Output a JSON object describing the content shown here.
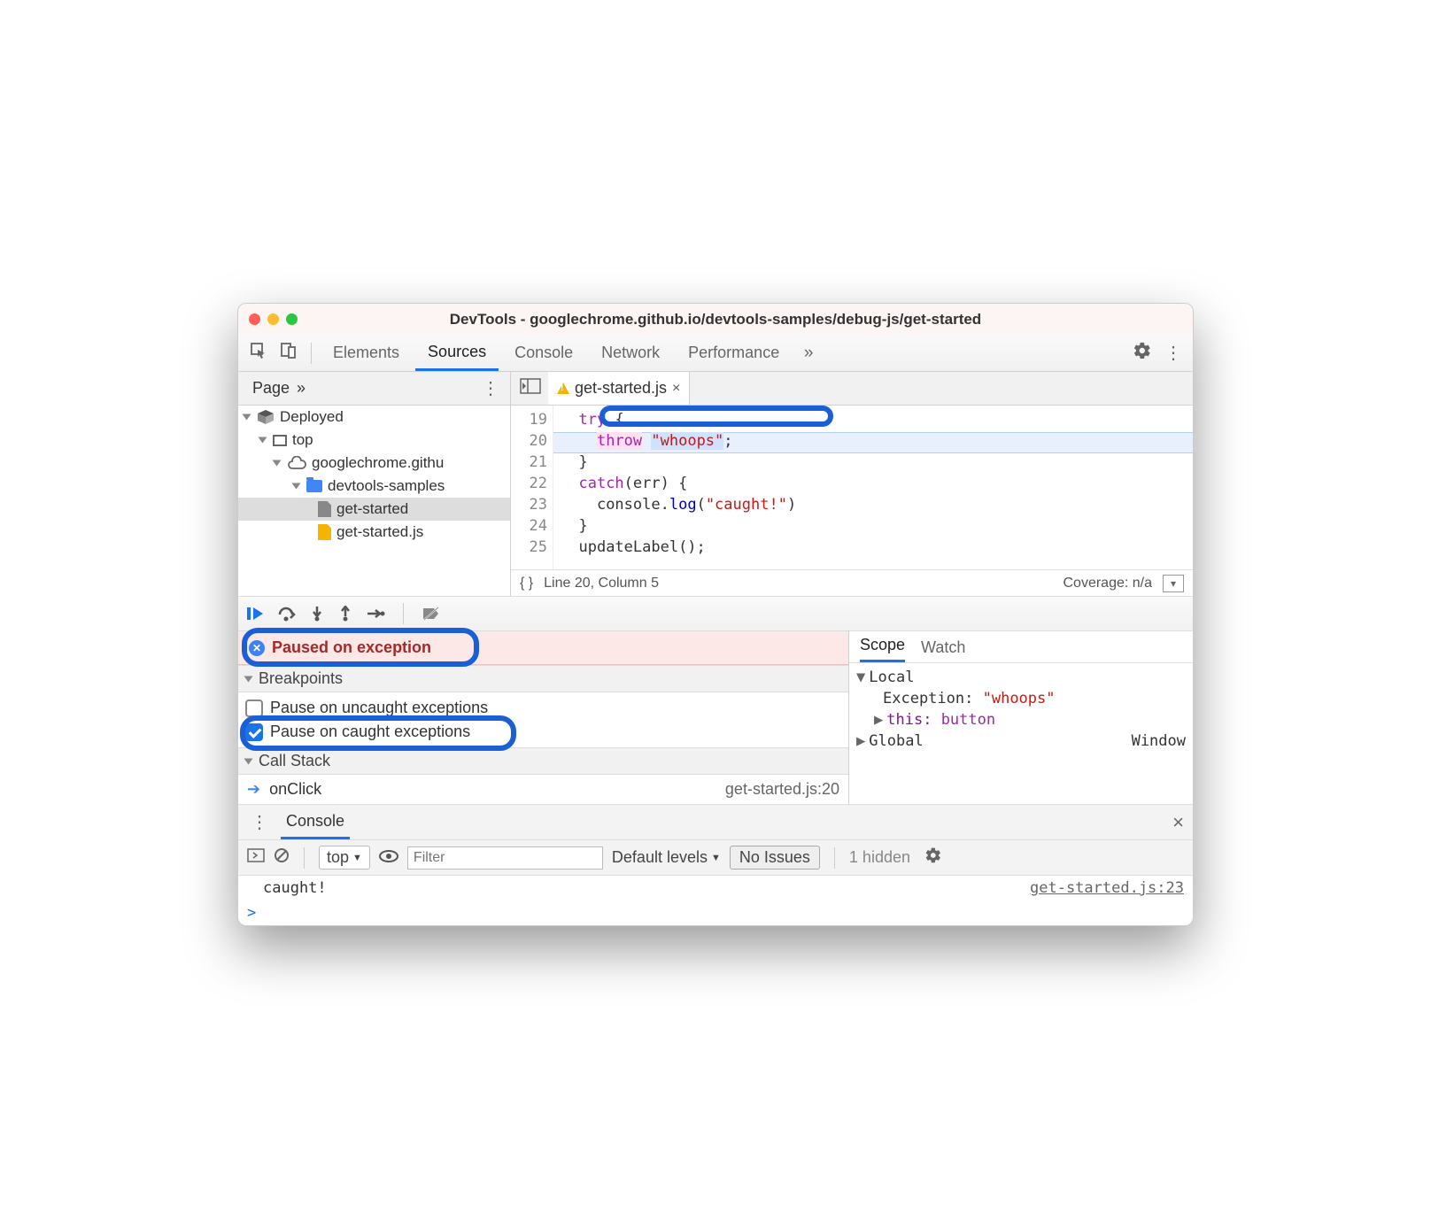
{
  "title": "DevTools - googlechrome.github.io/devtools-samples/debug-js/get-started",
  "tabs": [
    "Elements",
    "Sources",
    "Console",
    "Network",
    "Performance"
  ],
  "active_tab": "Sources",
  "nav_subtab": "Page",
  "file_tab": "get-started.js",
  "tree": {
    "deployed": "Deployed",
    "top": "top",
    "domain": "googlechrome.githu",
    "folder": "devtools-samples",
    "file1": "get-started",
    "file2": "get-started.js"
  },
  "code": {
    "lines": [
      "19",
      "20",
      "21",
      "22",
      "23",
      "24",
      "25"
    ],
    "l19_kw": "try",
    "l19_rest": " {",
    "l20_kw": "throw",
    "l20_str": "\"whoops\"",
    "l20_semi": ";",
    "l21": "}",
    "l22_kw": "catch",
    "l22_rest": "(err) {",
    "l23_pre": "  console.",
    "l23_fn": "log",
    "l23_op": "(",
    "l23_str": "\"caught!\"",
    "l23_cl": ")",
    "l24": "}",
    "l25": "updateLabel();"
  },
  "status": {
    "braces": "{ }",
    "pos": "Line 20, Column 5",
    "coverage": "Coverage: n/a"
  },
  "debugger": {
    "paused": "Paused on exception",
    "breakpoints_header": "Breakpoints",
    "bp1": "Pause on uncaught exceptions",
    "bp2": "Pause on caught exceptions",
    "callstack_header": "Call Stack",
    "frame": "onClick",
    "frame_loc": "get-started.js:20"
  },
  "scope": {
    "tab1": "Scope",
    "tab2": "Watch",
    "local": "Local",
    "exc_key": "Exception:",
    "exc_val": "\"whoops\"",
    "this_key": "this:",
    "this_val": "button",
    "global": "Global",
    "global_val": "Window"
  },
  "drawer": {
    "tab": "Console",
    "context": "top",
    "filter_placeholder": "Filter",
    "levels": "Default levels",
    "no_issues": "No Issues",
    "hidden": "1 hidden",
    "msg": "caught!",
    "msg_loc": "get-started.js:23",
    "prompt": ">"
  }
}
